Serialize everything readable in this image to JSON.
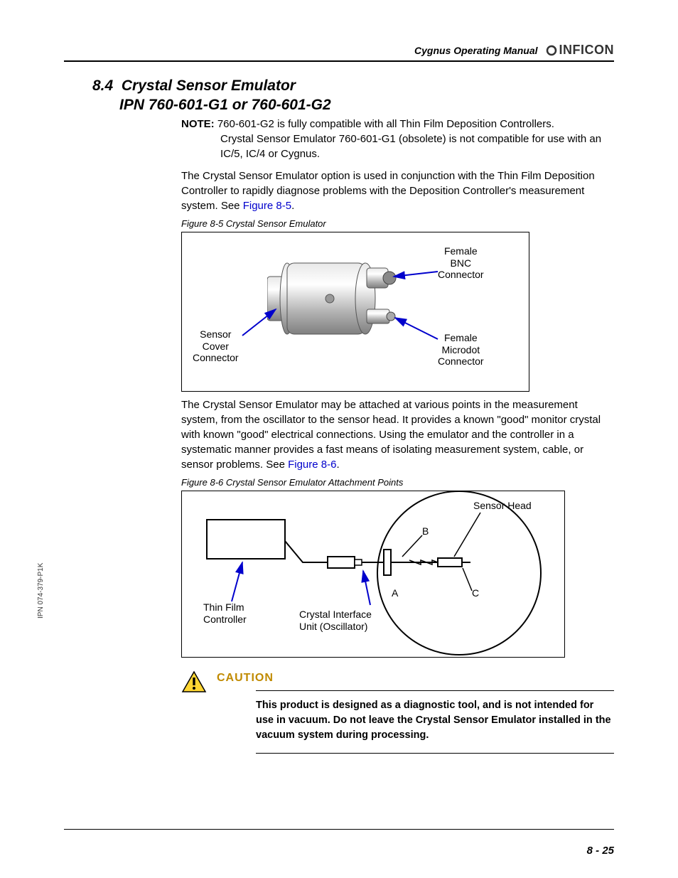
{
  "header": {
    "doc_title": "Cygnus Operating Manual",
    "brand": "INFICON"
  },
  "section": {
    "number": "8.4",
    "title_line1": "Crystal Sensor Emulator",
    "title_line2": "IPN 760-601-G1 or 760-601-G2"
  },
  "note": {
    "label": "NOTE:",
    "line1": "760-601-G2 is fully compatible with all Thin Film Deposition Controllers.",
    "line2": "Crystal Sensor Emulator 760-601-G1 (obsolete) is not compatible for use with an IC/5, IC/4 or Cygnus."
  },
  "para1": {
    "text": "The Crystal Sensor Emulator option is used in conjunction with the Thin Film Deposition Controller to rapidly diagnose problems with the Deposition Controller's measurement system. See ",
    "link": "Figure 8-5",
    "after": "."
  },
  "fig1": {
    "caption": "Figure 8-5  Crystal Sensor Emulator",
    "label_bnc_l1": "Female",
    "label_bnc_l2": "BNC",
    "label_bnc_l3": "Connector",
    "label_micro_l1": "Female",
    "label_micro_l2": "Microdot",
    "label_micro_l3": "Connector",
    "label_cover_l1": "Sensor",
    "label_cover_l2": "Cover",
    "label_cover_l3": "Connector"
  },
  "para2": {
    "text": "The Crystal Sensor Emulator may be attached at various points in the measurement system, from the oscillator to the sensor head. It provides a known \"good\" monitor crystal with known \"good\" electrical connections. Using the emulator and the controller in a systematic manner provides a fast means of isolating measurement system, cable, or sensor problems. See ",
    "link": "Figure 8-6",
    "after": "."
  },
  "fig2": {
    "caption": "Figure 8-6  Crystal Sensor Emulator Attachment Points",
    "sensor_head": "Sensor Head",
    "b": "B",
    "c": "C",
    "a": "A",
    "thin_film_l1": "Thin Film",
    "thin_film_l2": "Controller",
    "ciu_l1": "Crystal Interface",
    "ciu_l2": "Unit (Oscillator)"
  },
  "caution": {
    "title": "CAUTION",
    "text": "This product is designed as a diagnostic tool, and is not intended for use in vacuum. Do not leave the Crystal Sensor Emulator installed in the vacuum system during processing."
  },
  "footer": {
    "page": "8 - 25",
    "side_ipn": "IPN 074-379-P1K"
  }
}
